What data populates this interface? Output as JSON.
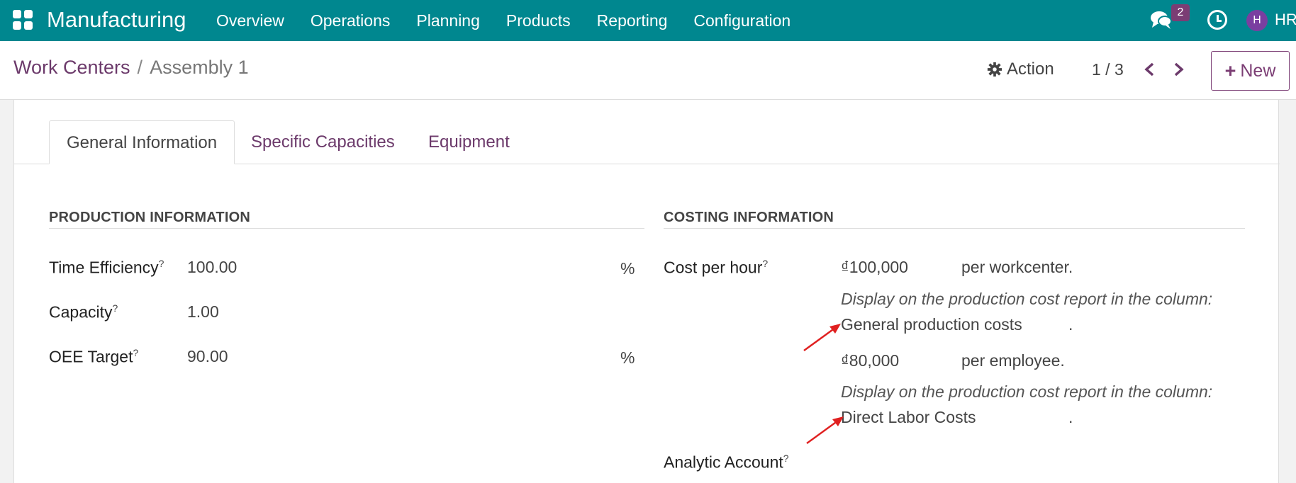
{
  "navbar": {
    "app_name": "Manufacturing",
    "menu": [
      "Overview",
      "Operations",
      "Planning",
      "Products",
      "Reporting",
      "Configuration"
    ],
    "chat_badge": "2",
    "avatar_initial": "H",
    "user_name": "HR",
    "icons": [
      "apps-grid-icon",
      "chat-icon",
      "clock-icon"
    ]
  },
  "control": {
    "breadcrumb_parent": "Work Centers",
    "breadcrumb_sep": "/",
    "breadcrumb_current": "Assembly 1",
    "action_label": "Action",
    "pager": "1 / 3",
    "new_label": "New",
    "new_plus": "+"
  },
  "tabs": [
    "General Information",
    "Specific Capacities",
    "Equipment"
  ],
  "production": {
    "title": "PRODUCTION INFORMATION",
    "rows": [
      {
        "label": "Time Efficiency",
        "value": "100.00",
        "unit": "%"
      },
      {
        "label": "Capacity",
        "value": "1.00",
        "unit": ""
      },
      {
        "label": "OEE Target",
        "value": "90.00",
        "unit": "%"
      }
    ]
  },
  "costing": {
    "title": "COSTING INFORMATION",
    "cost_label": "Cost per hour",
    "cost_value": "₫100,000",
    "cost_suffix": "per workcenter.",
    "hint1": "Display on the production cost report in the column:",
    "column1": "General production costs",
    "dot1": ".",
    "employee_value": "₫80,000",
    "employee_suffix": "per employee.",
    "hint2": "Display on the production cost report in the column:",
    "column2": "Direct Labor Costs",
    "dot2": ".",
    "analytic_label": "Analytic Account"
  },
  "help_mark": "?",
  "colors": {
    "navbar": "#00878f",
    "accent": "#6c3a6b",
    "annotation_arrow": "#e02020"
  }
}
